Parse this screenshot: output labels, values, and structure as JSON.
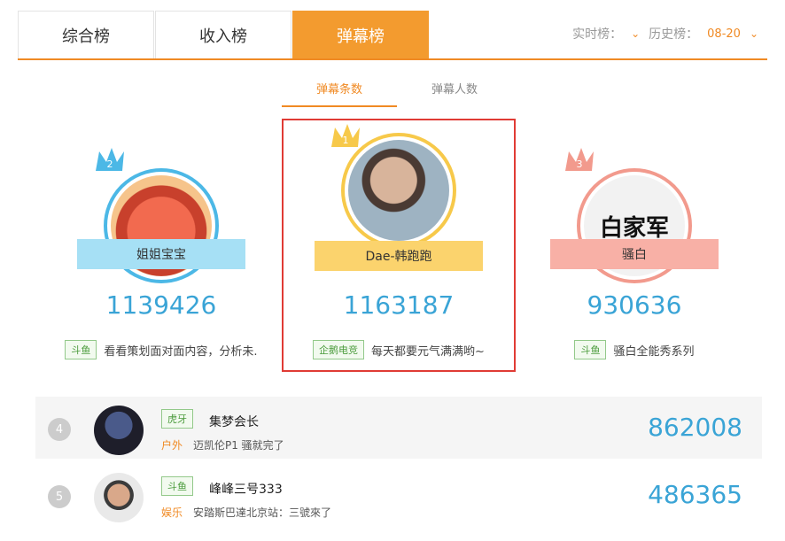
{
  "tabs": [
    "综合榜",
    "收入榜",
    "弹幕榜"
  ],
  "filters": {
    "realtime_label": "实时榜：",
    "history_label": "历史榜：",
    "history_value": "08-20"
  },
  "subtabs": [
    "弹幕条数",
    "弹幕人数"
  ],
  "podium": [
    {
      "rank": "2",
      "name": "姐姐宝宝",
      "score": "1139426",
      "platform": "斗鱼",
      "desc": "看看策划面对面内容，分析未."
    },
    {
      "rank": "1",
      "name": "Dae-韩跑跑",
      "score": "1163187",
      "platform": "企鹅电竞",
      "desc": "每天都要元气满满哟~"
    },
    {
      "rank": "3",
      "name": "骚白",
      "avatar_text": "白家军",
      "score": "930636",
      "platform": "斗鱼",
      "desc": "骚白全能秀系列"
    }
  ],
  "list": [
    {
      "rank": "4",
      "platform": "虎牙",
      "name": "集梦会长",
      "category": "户外",
      "desc": "迈凯伦P1 骚就完了",
      "score": "862008"
    },
    {
      "rank": "5",
      "platform": "斗鱼",
      "name": "峰峰三号333",
      "category": "娱乐",
      "desc": "安踏斯巴達北京站：三號來了",
      "score": "486365"
    }
  ],
  "colors": {
    "accent": "#f39b2f",
    "score": "#3aa4d6",
    "highlight": "#e03b35"
  }
}
